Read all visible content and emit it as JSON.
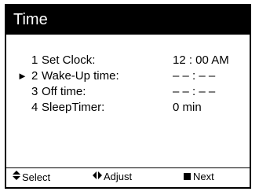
{
  "header": {
    "title": "Time"
  },
  "menu": {
    "items": [
      {
        "number": "1",
        "label": "Set Clock:",
        "value": "12 : 00 AM",
        "selected": false
      },
      {
        "number": "2",
        "label": "Wake-Up time:",
        "value": "– – : – –",
        "selected": true
      },
      {
        "number": "3",
        "label": "Off time:",
        "value": "– – : – –",
        "selected": false
      },
      {
        "number": "4",
        "label": "SleepTimer:",
        "value": "0 min",
        "selected": false
      }
    ],
    "pointer": "►"
  },
  "footer": {
    "select": {
      "icon": "up-down-arrow-icon",
      "label": "Select"
    },
    "adjust": {
      "icon": "left-right-arrow-icon",
      "label": "Adjust"
    },
    "next": {
      "icon": "square-icon",
      "label": "Next"
    }
  }
}
